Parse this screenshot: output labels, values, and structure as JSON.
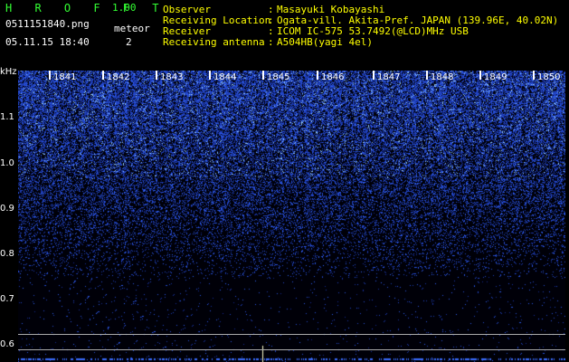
{
  "header": {
    "app_name": "H R O F F T",
    "version": "1.00",
    "filename": "0511151840.png",
    "datetime": "05.11.15 18:40",
    "meteor_label": "meteor",
    "meteor_count": "2"
  },
  "info": [
    {
      "label": "Observer",
      "value": "Masayuki Kobayashi"
    },
    {
      "label": "Receiving Location",
      "value": "Ogata-vill. Akita-Pref. JAPAN (139.96E, 40.02N)"
    },
    {
      "label": "Receiver",
      "value": "ICOM IC-575 53.7492(@LCD)MHz USB"
    },
    {
      "label": "Receiving antenna",
      "value": "A504HB(yagi 4el)"
    }
  ],
  "spectrogram": {
    "y_unit": "kHz",
    "y_ticks": [
      "1.1",
      "1.0",
      "0.9",
      "0.8",
      "0.7",
      "0.6"
    ],
    "time_labels": [
      "1841",
      "1842",
      "1843",
      "1844",
      "1845",
      "1846",
      "1847",
      "1848",
      "1849",
      "1850"
    ],
    "colors": {
      "signal": "#2a4bff",
      "bright": "#9fd4ff",
      "background": "#000000",
      "marker": "#ffffff"
    }
  }
}
